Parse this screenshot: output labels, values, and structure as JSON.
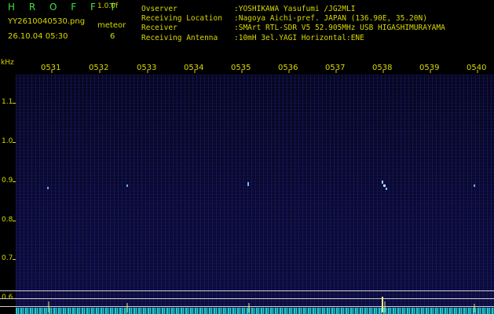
{
  "header": {
    "title": "H R O F F T",
    "version": "1.0.0f",
    "filename": "YY2610040530.png",
    "datetime": "26.10.04 05:30",
    "meteor_label": "meteor",
    "meteor_count": "6"
  },
  "info": [
    {
      "key": "Ovserver",
      "value": ":YOSHIKAWA Yasufumi /JG2MLI"
    },
    {
      "key": "Receiving Location",
      "value": ":Nagoya Aichi-pref. JAPAN (136.90E, 35.20N)"
    },
    {
      "key": "Receiver",
      "value": ":SMArt RTL-SDR V5 52.905MHz USB HIGASHIMURAYAMA"
    },
    {
      "key": "Receiving Antenna",
      "value": ":10mH 3el.YAGI Horizontal:ENE"
    }
  ],
  "time_axis": [
    "0531",
    "0532",
    "0533",
    "0534",
    "0535",
    "0536",
    "0537",
    "0538",
    "0539",
    "0540"
  ],
  "freq_axis": {
    "unit": "kHz",
    "labels": [
      "1.1",
      "1.0",
      "0.9",
      "0.8",
      "0.7",
      "0.6"
    ]
  },
  "colors": {
    "text": "#d8d800",
    "title": "#3fe03f",
    "echo": "#6aa8ff",
    "floor": "#25c8c8",
    "line": "#cfcfcf"
  }
}
